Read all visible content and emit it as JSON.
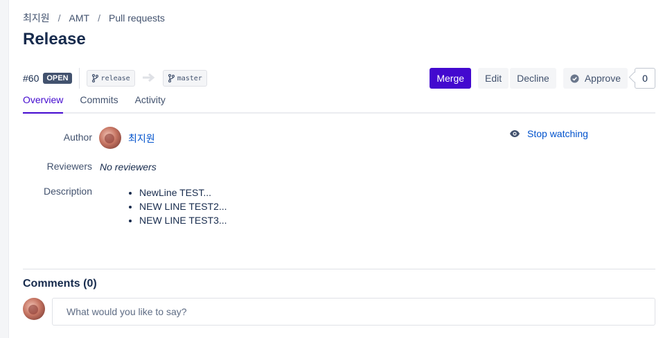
{
  "breadcrumb": {
    "items": [
      "최지원",
      "AMT",
      "Pull requests"
    ],
    "separator": "/"
  },
  "page_title": "Release",
  "pull_request": {
    "id": "#60",
    "status": "OPEN",
    "source_branch": "release",
    "target_branch": "master"
  },
  "actions": {
    "merge_label": "Merge",
    "edit_label": "Edit",
    "decline_label": "Decline",
    "approve_label": "Approve",
    "approve_count": "0"
  },
  "tabs": [
    {
      "label": "Overview",
      "active": true
    },
    {
      "label": "Commits",
      "active": false
    },
    {
      "label": "Activity",
      "active": false
    }
  ],
  "overview": {
    "author_label": "Author",
    "author_name": "최지원",
    "reviewers_label": "Reviewers",
    "reviewers_value": "No reviewers",
    "description_label": "Description",
    "description_items": [
      "NewLine TEST...",
      "NEW LINE TEST2...",
      "NEW LINE TEST3..."
    ],
    "watch_label": "Stop watching"
  },
  "comments": {
    "title": "Comments (0)",
    "placeholder": "What would you like to say?"
  },
  "icons": {
    "branch": "branch-icon",
    "arrow": "arrow-right-icon",
    "approve": "check-circle-icon",
    "watch": "eye-icon"
  },
  "colors": {
    "primary": "#4309cf",
    "link": "#0052cc",
    "status_badge": "#42526e"
  }
}
